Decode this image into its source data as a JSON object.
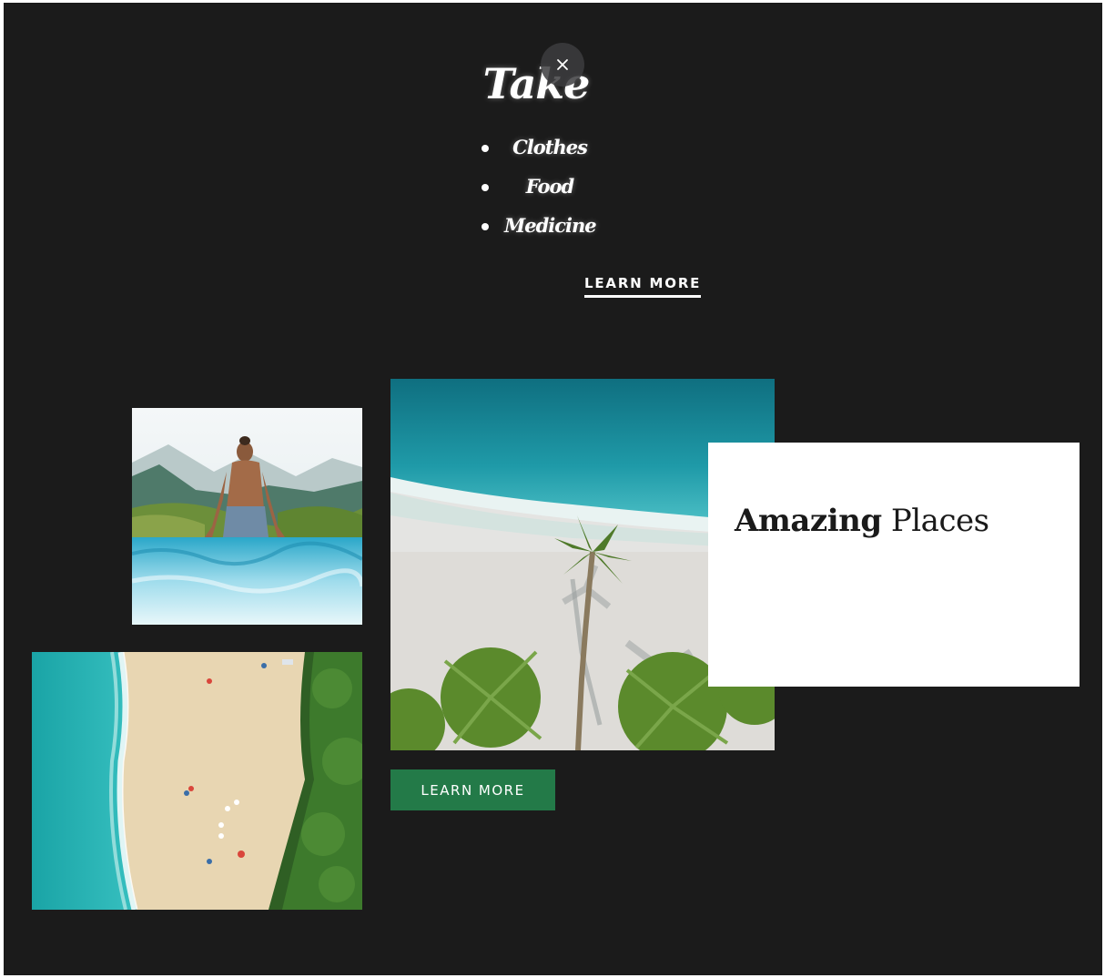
{
  "hero": {
    "title": "Take",
    "list": [
      {
        "label": "Clothes"
      },
      {
        "label": "Food"
      },
      {
        "label": "Medicine"
      }
    ],
    "learn_more": "LEARN MORE"
  },
  "gallery": {
    "card_title_bold": "Amazing",
    "card_title_rest": " Places",
    "button_label": "LEARN MORE"
  },
  "icons": {
    "close": "close-icon"
  },
  "colors": {
    "background": "#1b1b1b",
    "button_green": "#237a48",
    "card_white": "#ffffff"
  }
}
